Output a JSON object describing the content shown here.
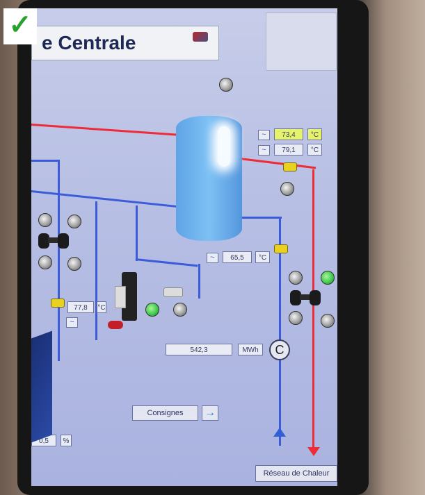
{
  "badge": {
    "icon": "checkmark-icon",
    "symbol": "✓",
    "color": "#2aa12f"
  },
  "header": {
    "title": "e Centrale"
  },
  "readouts": {
    "tank_top_temp": {
      "value": "73,4",
      "unit": "°C"
    },
    "tank_top_temp2": {
      "value": "79,1",
      "unit": "°C"
    },
    "tank_return_temp": {
      "value": "65,5",
      "unit": "°C"
    },
    "left_temp": {
      "value": "77,8",
      "unit": "°C"
    },
    "energy_meter": {
      "value": "542,3",
      "unit": "MWh"
    },
    "left_bottom_percent": {
      "value": "0,5",
      "unit": "%"
    }
  },
  "symbols": {
    "tilde": "~",
    "counter": "C",
    "arrow_right": "→"
  },
  "buttons": {
    "consignes": "Consignes",
    "reseau": "Réseau de Chaleur"
  },
  "colors": {
    "hot_pipe": "#ee2b36",
    "cold_pipe": "#3b5bd9",
    "valve": "#e8d21f",
    "indicator_on": "#3bc94a"
  }
}
